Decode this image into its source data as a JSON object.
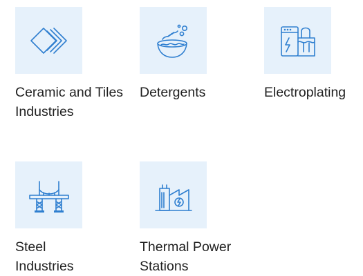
{
  "industries": [
    {
      "label": "Ceramic and Tiles Industries",
      "icon": "ceramic-tiles-icon"
    },
    {
      "label": "Detergents",
      "icon": "detergent-bowl-icon"
    },
    {
      "label": "Electroplating",
      "icon": "electroplating-tank-icon"
    },
    {
      "label": "Steel Industries",
      "icon": "steel-bridge-icon"
    },
    {
      "label": "Thermal Power Stations",
      "icon": "power-station-icon"
    }
  ],
  "colors": {
    "tile_background": "#e6f1fb",
    "icon_stroke": "#2f7fd0",
    "text": "#1f1f1f"
  }
}
